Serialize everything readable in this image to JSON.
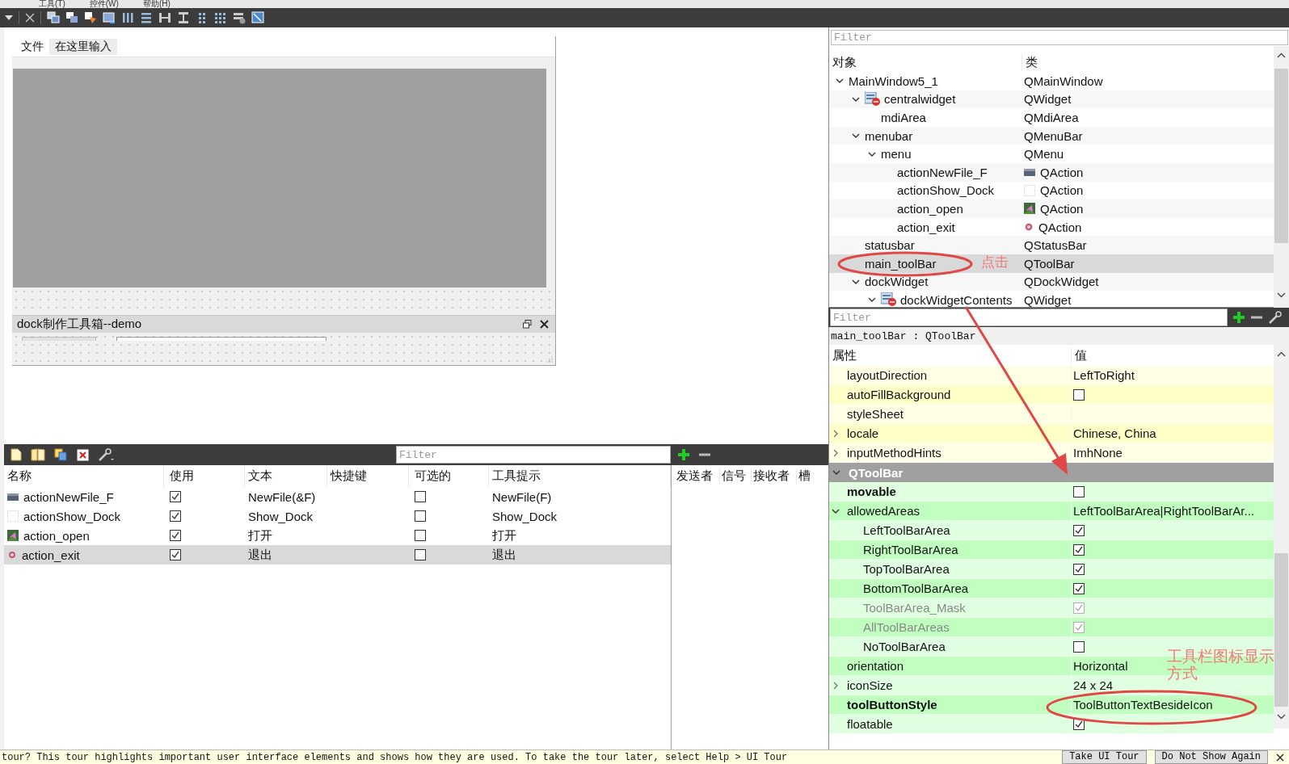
{
  "menu_bar": {
    "items": [
      "工具(T)",
      "控件(W)",
      "帮助(H)"
    ]
  },
  "form": {
    "menus": [
      {
        "label": "文件",
        "kind": "menu"
      },
      {
        "label": "在这里输入",
        "kind": "placeholder"
      }
    ],
    "dock": {
      "title": "dock制作工具箱--demo"
    }
  },
  "action_editor": {
    "filter": {
      "placeholder": "Filter"
    },
    "columns": [
      "名称",
      "使用",
      "文本",
      "快捷键",
      "可选的",
      "工具提示"
    ],
    "rows": [
      {
        "name": "actionNewFile_F",
        "kind": "new",
        "used": true,
        "text": "NewFile(&F)",
        "checkable": false,
        "tooltip": "NewFile(F)",
        "selected": false
      },
      {
        "name": "actionShow_Dock",
        "kind": "plain",
        "used": true,
        "text": "Show_Dock",
        "checkable": false,
        "tooltip": "Show_Dock",
        "selected": false
      },
      {
        "name": "action_open",
        "kind": "open",
        "used": true,
        "text": "打开",
        "checkable": false,
        "tooltip": "打开",
        "selected": false
      },
      {
        "name": "action_exit",
        "kind": "exit",
        "used": true,
        "text": "退出",
        "checkable": false,
        "tooltip": "退出",
        "selected": true
      }
    ]
  },
  "signal_slot_editor": {
    "columns": [
      "发送者",
      "信号",
      "接收者",
      "槽"
    ]
  },
  "object_inspector": {
    "filter": {
      "placeholder": "Filter"
    },
    "columns": [
      "对象",
      "类"
    ],
    "tree": [
      {
        "name": "MainWindow5_1",
        "class": "QMainWindow",
        "expanded": true,
        "selected": false,
        "children": [
          {
            "name": "centralwidget",
            "class": "QWidget",
            "kind": "container",
            "expanded": true,
            "selected": false,
            "children": [
              {
                "name": "mdiArea",
                "class": "QMdiArea",
                "selected": false
              }
            ]
          },
          {
            "name": "menubar",
            "class": "QMenuBar",
            "expanded": true,
            "selected": false,
            "children": [
              {
                "name": "menu",
                "class": "QMenu",
                "expanded": true,
                "selected": false,
                "children": [
                  {
                    "name": "actionNewFile_F",
                    "class": "QAction",
                    "kind": "new",
                    "selected": false
                  },
                  {
                    "name": "actionShow_Dock",
                    "class": "QAction",
                    "kind": "plain",
                    "selected": false
                  },
                  {
                    "name": "action_open",
                    "class": "QAction",
                    "kind": "open",
                    "selected": false
                  },
                  {
                    "name": "action_exit",
                    "class": "QAction",
                    "kind": "exit",
                    "selected": false
                  }
                ]
              }
            ]
          },
          {
            "name": "statusbar",
            "class": "QStatusBar",
            "selected": false
          },
          {
            "name": "main_toolBar",
            "class": "QToolBar",
            "selected": true
          },
          {
            "name": "dockWidget",
            "class": "QDockWidget",
            "expanded": true,
            "selected": false,
            "children": [
              {
                "name": "dockWidgetContents",
                "class": "QWidget",
                "kind": "container",
                "expanded": true,
                "selected": false
              }
            ]
          }
        ]
      }
    ]
  },
  "property_editor": {
    "filter": {
      "placeholder": "Filter"
    },
    "object_label": "main_toolBar : QToolBar",
    "columns": [
      "属性",
      "值"
    ],
    "rows": [
      {
        "name": "layoutDirection",
        "kind": "text",
        "value": "LeftToRight",
        "modified": false,
        "disabled": false
      },
      {
        "name": "autoFillBackground",
        "kind": "check",
        "checked": false,
        "modified": false,
        "disabled": false
      },
      {
        "name": "styleSheet",
        "kind": "text",
        "modified": false,
        "disabled": false
      },
      {
        "name": "locale",
        "kind": "text",
        "value": "Chinese, China",
        "expanded": false,
        "modified": false,
        "disabled": false
      },
      {
        "name": "inputMethodHints",
        "kind": "text",
        "value": "ImhNone",
        "expanded": false,
        "modified": false,
        "disabled": false
      }
    ],
    "groups": [
      {
        "title": "QToolBar",
        "expanded": true,
        "rows": [
          {
            "name": "movable",
            "kind": "check",
            "checked": false,
            "modified": true,
            "disabled": false
          },
          {
            "name": "allowedAreas",
            "kind": "text",
            "value": "LeftToolBarArea|RightToolBarAr...",
            "expanded": true,
            "modified": false,
            "disabled": false,
            "children": [
              {
                "name": "LeftToolBarArea",
                "kind": "check",
                "checked": true,
                "modified": false,
                "disabled": false
              },
              {
                "name": "RightToolBarArea",
                "kind": "check",
                "checked": true,
                "modified": false,
                "disabled": false
              },
              {
                "name": "TopToolBarArea",
                "kind": "check",
                "checked": true,
                "modified": false,
                "disabled": false
              },
              {
                "name": "BottomToolBarArea",
                "kind": "check",
                "checked": true,
                "modified": false,
                "disabled": false
              },
              {
                "name": "ToolBarArea_Mask",
                "kind": "check",
                "checked": true,
                "modified": false,
                "disabled": true
              },
              {
                "name": "AllToolBarAreas",
                "kind": "check",
                "checked": true,
                "modified": false,
                "disabled": true
              },
              {
                "name": "NoToolBarArea",
                "kind": "check",
                "checked": false,
                "modified": false,
                "disabled": false
              }
            ]
          },
          {
            "name": "orientation",
            "kind": "text",
            "value": "Horizontal",
            "modified": false,
            "disabled": false
          },
          {
            "name": "iconSize",
            "kind": "text",
            "value": "24 x 24",
            "expanded": false,
            "modified": false,
            "disabled": false
          },
          {
            "name": "toolButtonStyle",
            "kind": "text",
            "value": "ToolButtonTextBesideIcon",
            "modified": true,
            "disabled": false
          },
          {
            "name": "floatable",
            "kind": "check",
            "checked": true,
            "modified": false,
            "disabled": false
          }
        ]
      }
    ]
  },
  "annotations": [
    {
      "kind": "ellipse"
    },
    {
      "kind": "note",
      "text": "点击"
    },
    {
      "kind": "arrow"
    },
    {
      "kind": "note",
      "text": "工具栏图标显示方式"
    },
    {
      "kind": "ellipse"
    }
  ],
  "status_bar": {
    "message": "tour? This tour highlights important user interface elements and shows how they are used. To take the tour later, select Help > UI Tour",
    "buttons": [
      "Take UI Tour",
      "Do Not Show Again"
    ]
  }
}
